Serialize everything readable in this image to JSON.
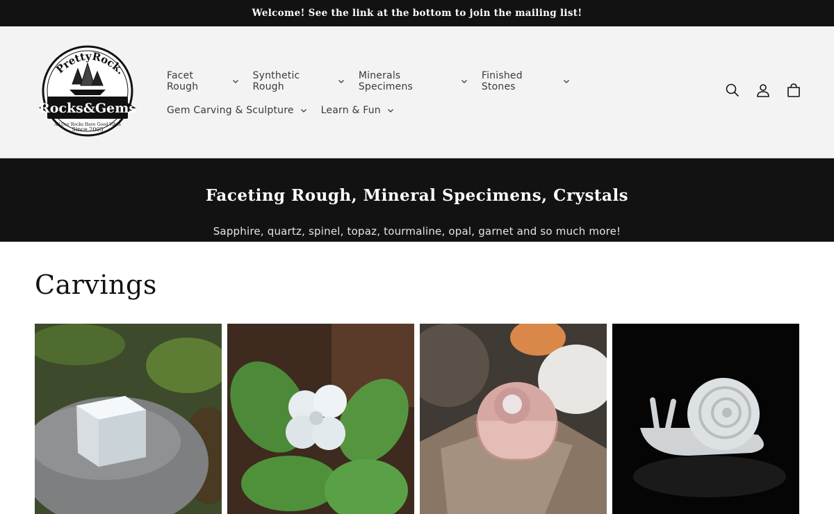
{
  "announcement": {
    "text": "Welcome! See the link at the bottom to join the mailing list!"
  },
  "logo": {
    "top_text": "PrettyRock.com",
    "banner_text": "Rocks&Gems",
    "tagline": "All Our Rocks Have Good Vibes",
    "since": "Since 2005"
  },
  "nav": {
    "row1": [
      {
        "label": "Facet Rough"
      },
      {
        "label": "Synthetic Rough"
      },
      {
        "label": "Minerals Specimens"
      },
      {
        "label": "Finished Stones"
      }
    ],
    "row2": [
      {
        "label": "Gem Carving & Sculpture"
      },
      {
        "label": "Learn & Fun"
      }
    ]
  },
  "header_icons": [
    "search-icon",
    "account-icon",
    "cart-icon"
  ],
  "banner": {
    "title": "Faceting Rough, Mineral Specimens, Crystals",
    "subtitle": "Sapphire, quartz, spinel, topaz, tourmaline, opal, garnet and so much more!"
  },
  "collection": {
    "title": "Carvings",
    "products": [
      {
        "image": "quartz-cube-carving"
      },
      {
        "image": "quartz-clover-carving"
      },
      {
        "image": "pink-agate-shell-carving"
      },
      {
        "image": "quartz-snail-carving"
      }
    ]
  },
  "colors": {
    "announcement_bg": "#121212",
    "header_bg": "#f3f3f3",
    "banner_bg": "#121212",
    "text": "#121212"
  }
}
